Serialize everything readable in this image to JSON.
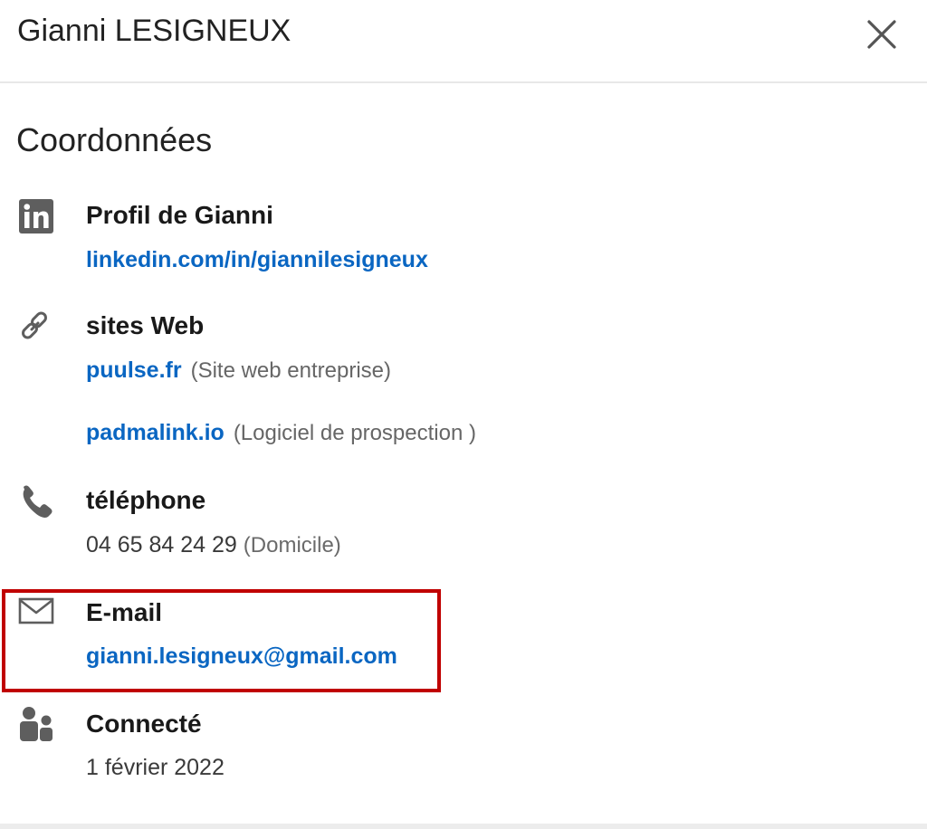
{
  "header": {
    "title": "Gianni LESIGNEUX",
    "close_icon": "close-icon"
  },
  "section": {
    "title": "Coordonnées"
  },
  "profile": {
    "icon": "linkedin-icon",
    "label": "Profil de Gianni",
    "url": "linkedin.com/in/giannilesigneux"
  },
  "websites": {
    "icon": "link-icon",
    "label": "sites Web",
    "items": [
      {
        "url": "puulse.fr",
        "note": "(Site web entreprise)"
      },
      {
        "url": "padmalink.io",
        "note": "(Logiciel de prospection )"
      }
    ]
  },
  "phone": {
    "icon": "phone-icon",
    "label": "téléphone",
    "number": "04 65 84 24 29",
    "note": "(Domicile)"
  },
  "email": {
    "icon": "envelope-icon",
    "label": "E-mail",
    "address": "gianni.lesigneux@gmail.com",
    "highlight_color": "#c00000"
  },
  "connected": {
    "icon": "people-icon",
    "label": "Connecté",
    "date": "1 février 2022"
  },
  "colors": {
    "link": "#0a66c2",
    "icon": "#5e5e5e",
    "text": "#191919",
    "muted": "#666666"
  }
}
